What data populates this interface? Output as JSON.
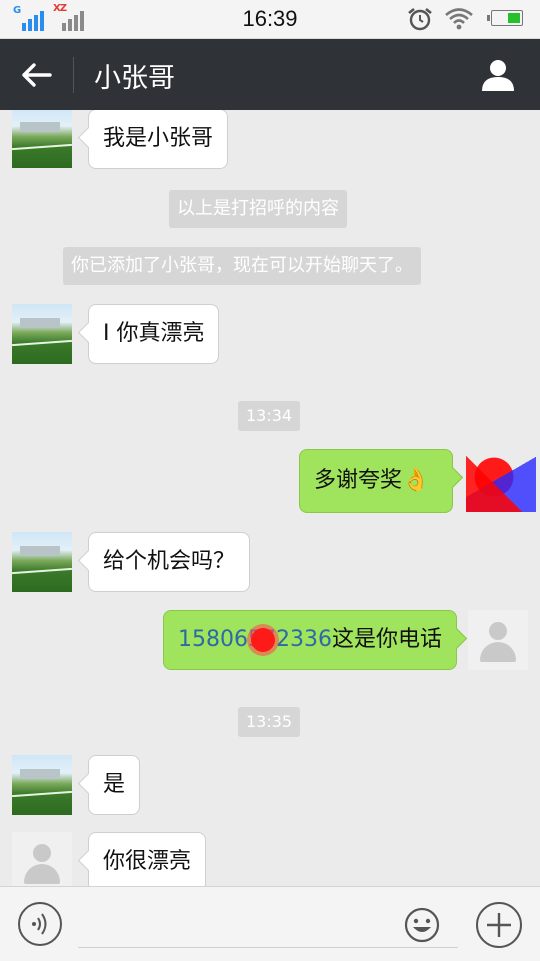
{
  "status_bar": {
    "sim1_label": "G",
    "sim2_label": "XZ",
    "time": "16:39",
    "icons": [
      "signal-icon",
      "alarm-clock-icon",
      "wifi-icon",
      "battery-icon"
    ]
  },
  "header": {
    "title": "小张哥",
    "icons": [
      "back-arrow-icon",
      "profile-icon"
    ]
  },
  "messages": [
    {
      "type": "incoming",
      "avatar": "grass-field",
      "text": "我是小张哥"
    },
    {
      "type": "system",
      "text": "以上是打招呼的内容"
    },
    {
      "type": "system",
      "text": "你已添加了小张哥，现在可以开始聊天了。"
    },
    {
      "type": "incoming",
      "avatar": "grass-field",
      "text": "I 你真漂亮"
    },
    {
      "type": "timestamp",
      "text": "13:34"
    },
    {
      "type": "outgoing",
      "avatar": "redacted",
      "text": "多谢夸奖",
      "emoji": "👌"
    },
    {
      "type": "incoming",
      "avatar": "grass-field",
      "text": "给个机会吗？"
    },
    {
      "type": "outgoing",
      "avatar": "default",
      "phone": "15806572336",
      "text": "这是你电话"
    },
    {
      "type": "timestamp",
      "text": "13:35"
    },
    {
      "type": "incoming",
      "avatar": "grass-field",
      "text": "是"
    },
    {
      "type": "incoming",
      "avatar": "default",
      "text": "你很漂亮"
    }
  ],
  "input_bar": {
    "placeholder": "",
    "icons": [
      "voice-icon",
      "emoji-icon",
      "plus-icon"
    ]
  },
  "colors": {
    "header_bg": "#2f3236",
    "chat_bg": "#ebebeb",
    "outgoing_bubble": "#a0e35c",
    "incoming_bubble": "#ffffff",
    "system_bg": "#d6d6d6",
    "phone_link": "#2c6aa6"
  }
}
